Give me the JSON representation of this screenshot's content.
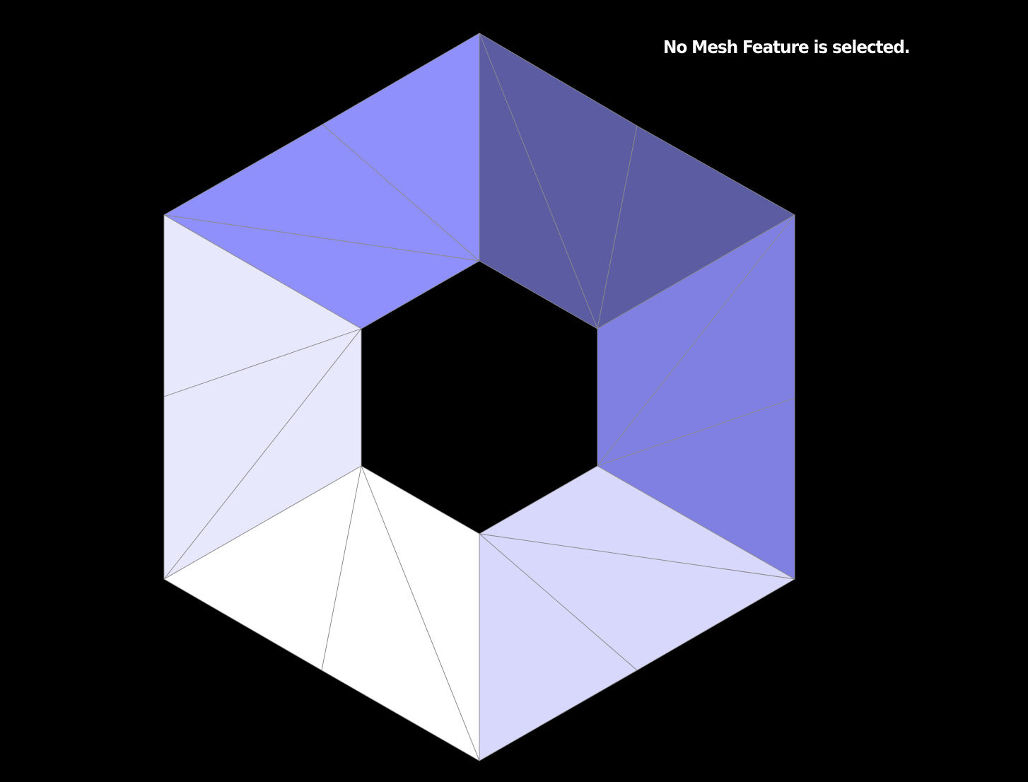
{
  "status": {
    "message": "No Mesh Feature is selected."
  },
  "mesh": {
    "colors": {
      "background": "#000000",
      "edge_stroke": "#8a8a8a",
      "segment_top_left": "#9090fc",
      "segment_top_right": "#5c5ca3",
      "segment_right": "#8080e3",
      "segment_bottom_right": "#d8d8fc",
      "segment_bottom_left": "#ffffff",
      "segment_left": "#e8e8fd"
    }
  }
}
